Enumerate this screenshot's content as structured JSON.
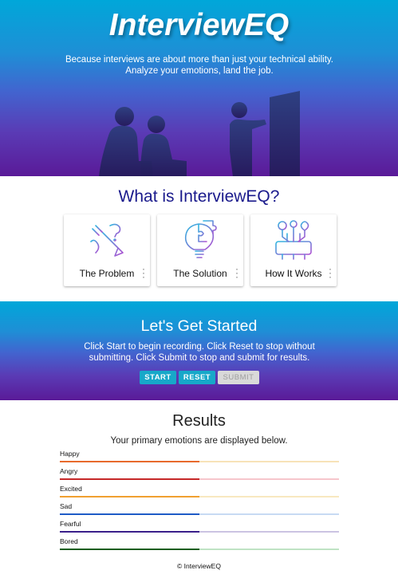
{
  "hero": {
    "title": "InterviewEQ",
    "tagline_1": "Because interviews are about more than just your technical ability.",
    "tagline_2": "Analyze your emotions, land the job."
  },
  "what": {
    "heading": "What is InterviewEQ?",
    "cards": [
      {
        "label": "The Problem",
        "icon": "pen-question-icon"
      },
      {
        "label": "The Solution",
        "icon": "puzzle-bulb-icon"
      },
      {
        "label": "How It Works",
        "icon": "circuit-icon"
      }
    ]
  },
  "start": {
    "heading": "Let's Get Started",
    "instructions": "Click Start to begin recording. Click Reset to stop without submitting. Click Submit to stop and submit for results.",
    "start_label": "START",
    "reset_label": "RESET",
    "submit_label": "SUBMIT"
  },
  "results": {
    "heading": "Results",
    "subtitle": "Your primary emotions are displayed below.",
    "emotions": [
      {
        "name": "Happy",
        "level": 0.5,
        "color": "#e86a2c",
        "track": "#f7e3b8"
      },
      {
        "name": "Angry",
        "level": 0.5,
        "color": "#c62828",
        "track": "#f6c6cc"
      },
      {
        "name": "Excited",
        "level": 0.5,
        "color": "#f0a030",
        "track": "#f8e8c0"
      },
      {
        "name": "Sad",
        "level": 0.5,
        "color": "#1e5bc6",
        "track": "#c7daf3"
      },
      {
        "name": "Fearful",
        "level": 0.5,
        "color": "#3a1f8a",
        "track": "#cbc3e2"
      },
      {
        "name": "Bored",
        "level": 0.5,
        "color": "#1b5e20",
        "track": "#bfe3c4"
      }
    ]
  },
  "footer": "© InterviewEQ"
}
